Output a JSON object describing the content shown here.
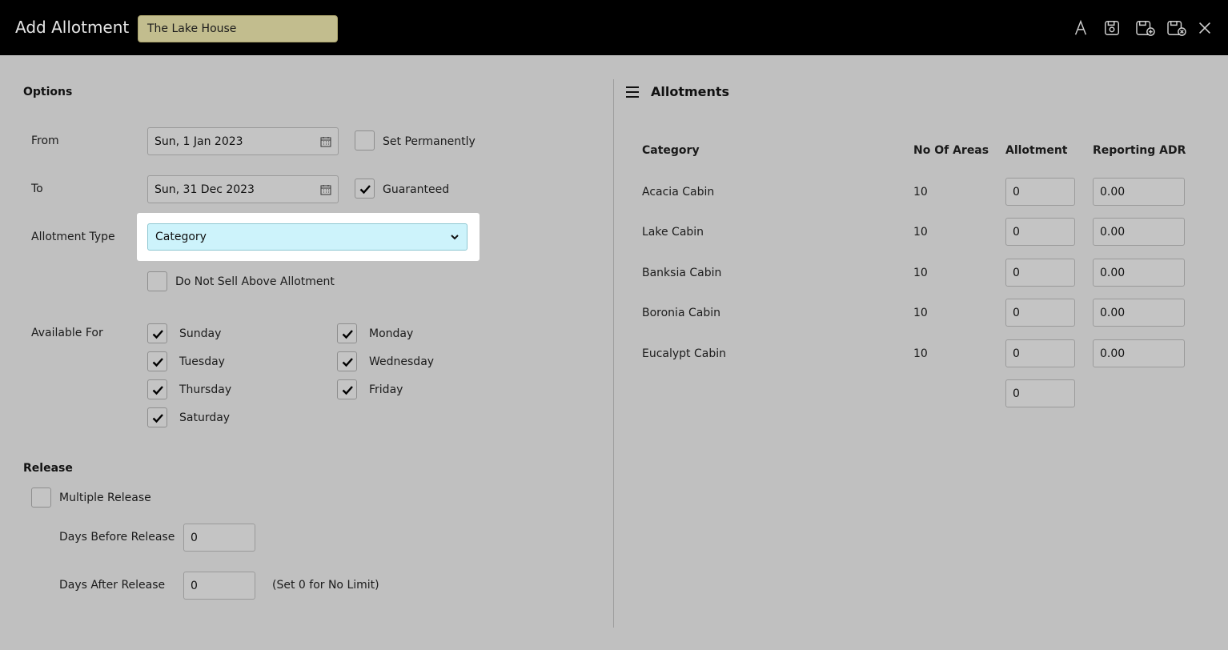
{
  "header": {
    "title": "Add Allotment",
    "property": "The Lake House",
    "icons": [
      "font-icon",
      "save-icon",
      "save-add-icon",
      "save-close-icon",
      "close-icon"
    ]
  },
  "options": {
    "section_title": "Options",
    "from_label": "From",
    "from_value": "Sun, 1 Jan 2023",
    "to_label": "To",
    "to_value": "Sun, 31 Dec 2023",
    "set_permanently": {
      "label": "Set Permanently",
      "checked": false
    },
    "guaranteed": {
      "label": "Guaranteed",
      "checked": true
    },
    "allotment_type_label": "Allotment Type",
    "allotment_type_value": "Category",
    "do_not_sell": {
      "label": "Do Not Sell Above Allotment",
      "checked": false
    },
    "available_for_label": "Available For",
    "days": [
      {
        "label": "Sunday",
        "checked": true
      },
      {
        "label": "Monday",
        "checked": true
      },
      {
        "label": "Tuesday",
        "checked": true
      },
      {
        "label": "Wednesday",
        "checked": true
      },
      {
        "label": "Thursday",
        "checked": true
      },
      {
        "label": "Friday",
        "checked": true
      },
      {
        "label": "Saturday",
        "checked": true
      }
    ]
  },
  "release": {
    "section_title": "Release",
    "multiple_release": {
      "label": "Multiple Release",
      "checked": false
    },
    "days_before_label": "Days Before Release",
    "days_before_value": "0",
    "days_after_label": "Days After Release",
    "days_after_value": "0",
    "days_after_hint": "(Set 0 for No Limit)"
  },
  "allotments": {
    "title": "Allotments",
    "columns": [
      "Category",
      "No Of Areas",
      "Allotment",
      "Reporting ADR"
    ],
    "rows": [
      {
        "category": "Acacia Cabin",
        "areas": "10",
        "allotment": "0",
        "adr": "0.00"
      },
      {
        "category": "Lake Cabin",
        "areas": "10",
        "allotment": "0",
        "adr": "0.00"
      },
      {
        "category": "Banksia Cabin",
        "areas": "10",
        "allotment": "0",
        "adr": "0.00"
      },
      {
        "category": "Boronia Cabin",
        "areas": "10",
        "allotment": "0",
        "adr": "0.00"
      },
      {
        "category": "Eucalypt Cabin",
        "areas": "10",
        "allotment": "0",
        "adr": "0.00"
      }
    ],
    "total_allotment": "0"
  },
  "colors": {
    "topbar": "#000000",
    "background": "#c0c0c0",
    "property_field": "#c2bd8e",
    "select_highlight": "#cdf3fb"
  }
}
